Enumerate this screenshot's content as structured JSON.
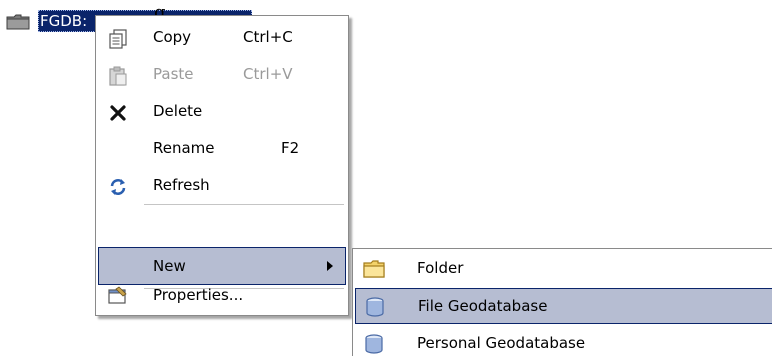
{
  "tree": {
    "node_label": "FGDB:",
    "caption_fragment": "g"
  },
  "context_menu": {
    "items": [
      {
        "label": "Copy",
        "shortcut": "Ctrl+C",
        "icon": "copy-icon",
        "enabled": true
      },
      {
        "label": "Paste",
        "shortcut": "Ctrl+V",
        "icon": "paste-icon",
        "enabled": false
      },
      {
        "label": "Delete",
        "shortcut": "",
        "icon": "delete-icon",
        "enabled": true
      },
      {
        "label": "Rename",
        "shortcut": "F2",
        "icon": "",
        "enabled": true
      },
      {
        "label": "Refresh",
        "shortcut": "",
        "icon": "refresh-icon",
        "enabled": true
      },
      {
        "label": "New",
        "shortcut": "",
        "icon": "",
        "enabled": true,
        "has_submenu": true,
        "highlighted": true
      },
      {
        "label": "Properties...",
        "shortcut": "",
        "icon": "properties-icon",
        "enabled": true
      }
    ]
  },
  "submenu": {
    "items": [
      {
        "label": "Folder",
        "icon": "folder-icon"
      },
      {
        "label": "File Geodatabase",
        "icon": "geodatabase-icon",
        "highlighted": true
      },
      {
        "label": "Personal Geodatabase",
        "icon": "geodatabase-icon"
      }
    ]
  },
  "colors": {
    "selection": "#0a246a",
    "menu_highlight": "#b6bdd2",
    "disabled_text": "#9a9a9a"
  }
}
